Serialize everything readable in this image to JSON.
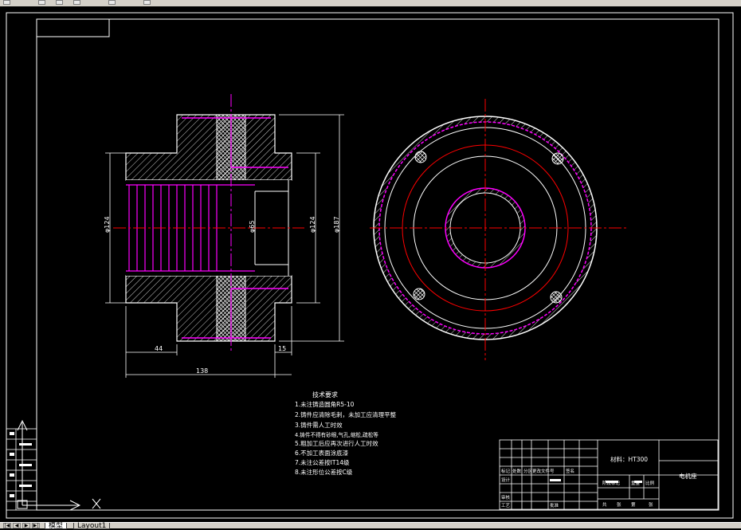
{
  "drawing": {
    "dims": {
      "d124_left": "φ124",
      "d65": "φ65",
      "d124_right": "φ124",
      "d187": "φ187",
      "w44": "44",
      "w15": "15",
      "w138": "138"
    },
    "notes": {
      "title": "技术要求",
      "items": [
        "1.未注铸造圆角R5-10",
        "2.铸件应清除毛刺，未加工应清理平整",
        "3.铸件需人工时效",
        "4.铸件不得有砂眼,气孔,缩松,疏松等",
        "5.粗加工后应再次进行人工时效",
        "6.不加工表面涂底漆",
        "7.未注公差按IT14级",
        "8.未注形位公差按C级"
      ]
    },
    "title_block": {
      "material": "材料：HT300",
      "part_name": "电机座",
      "labels": [
        "标记",
        "处数",
        "分区",
        "更改文件号",
        "签名",
        "设计",
        "审核",
        "工艺",
        "批准",
        "阶段标记",
        "重量",
        "比例",
        "共",
        "张",
        "第",
        "张"
      ]
    }
  },
  "tabs": [
    {
      "label": "模型",
      "active": true
    },
    {
      "label": "Layout1",
      "active": false
    }
  ],
  "nav_buttons": [
    "|◀",
    "◀",
    "▶",
    "▶|"
  ],
  "colors": {
    "background": "#000000",
    "outline": "#ffffff",
    "centerline": "#ff0000",
    "hidden": "#ff00ff"
  }
}
